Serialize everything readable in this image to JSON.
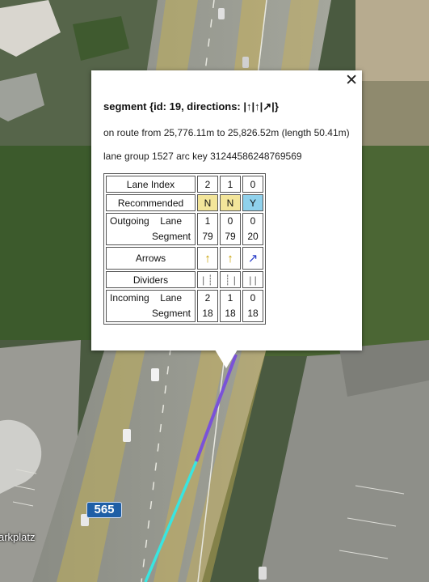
{
  "map": {
    "place_label": "arkplatz",
    "route_shield": "565",
    "colors": {
      "route_purple": "#7a52d8",
      "route_cyan": "#39e5e0",
      "highlight_yellow": "#c9b254"
    }
  },
  "popup": {
    "close_label": "✕",
    "title": "segment {id: 19, directions: |↑|↑|↗|}",
    "route_text": "on route from 25,776.11m to 25,826.52m (length 50.41m)",
    "lane_group_text": "lane group 1527 arc key 31244586248769569",
    "table": {
      "lane_index": {
        "label": "Lane Index",
        "values": [
          "2",
          "1",
          "0"
        ]
      },
      "recommended": {
        "label": "Recommended",
        "values": [
          "N",
          "N",
          "Y"
        ]
      },
      "outgoing": {
        "label": "Outgoing",
        "lane_label": "Lane",
        "segment_label": "Segment",
        "lane_values": [
          "1",
          "0",
          "0"
        ],
        "segment_values": [
          "79",
          "79",
          "20"
        ]
      },
      "arrows": {
        "label": "Arrows",
        "values": [
          "↑",
          "↑",
          "↗"
        ]
      },
      "dividers": {
        "label": "Dividers",
        "values": [
          "| ┊",
          "┊ |",
          "| |"
        ]
      },
      "incoming": {
        "label": "Incoming",
        "lane_label": "Lane",
        "segment_label": "Segment",
        "lane_values": [
          "2",
          "1",
          "0"
        ],
        "segment_values": [
          "18",
          "18",
          "18"
        ]
      }
    }
  }
}
